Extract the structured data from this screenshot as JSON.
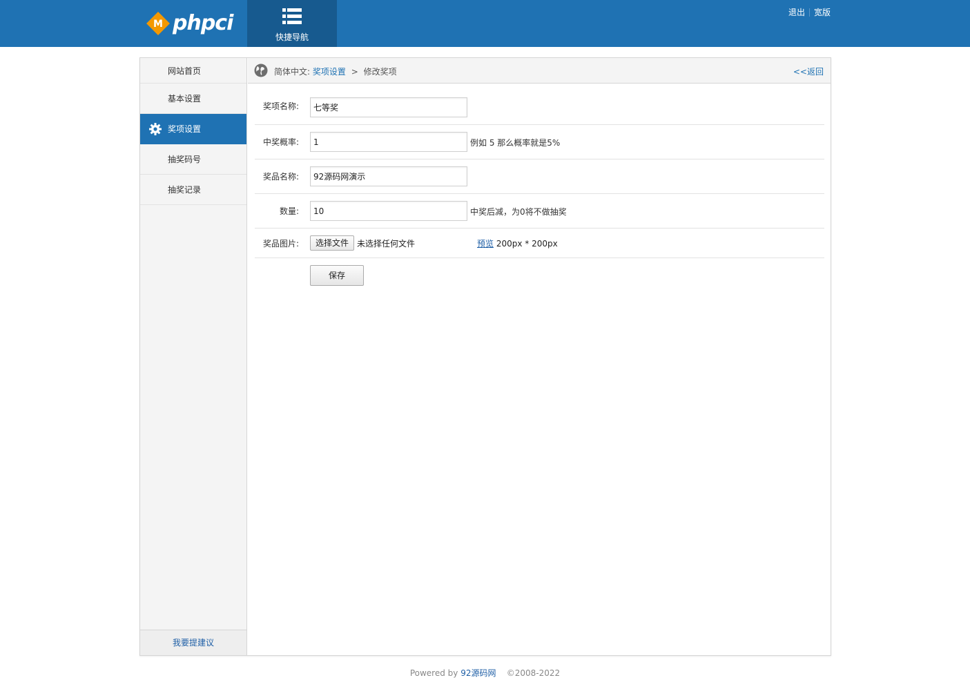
{
  "header": {
    "logo_text": "phpci",
    "logo_letter": "M",
    "quick_nav_label": "快捷导航",
    "logout_label": "退出",
    "wide_label": "宽版",
    "colors": {
      "bar": "#1f72b3",
      "quicknav": "#175a8f",
      "logo_orange": "#f39800"
    }
  },
  "sidebar": {
    "items": [
      {
        "label": "网站首页",
        "active": false
      },
      {
        "label": "基本设置",
        "active": false
      },
      {
        "label": "奖项设置",
        "active": true,
        "icon": "gear-icon"
      },
      {
        "label": "抽奖码号",
        "active": false
      },
      {
        "label": "抽奖记录",
        "active": false
      }
    ],
    "feedback_label": "我要提建议"
  },
  "breadcrumb": {
    "root": "简体中文:",
    "link": "奖项设置",
    "separator": ">",
    "current": "修改奖项",
    "back_label": "<<返回"
  },
  "form": {
    "prize_name": {
      "label": "奖项名称:",
      "value": "七等奖"
    },
    "probability": {
      "label": "中奖概率:",
      "value": "1",
      "hint": "例如 5 那么概率就是5%"
    },
    "goods_name": {
      "label": "奖品名称:",
      "value": "92源码网演示"
    },
    "quantity": {
      "label": "数量:",
      "value": "10",
      "hint": "中奖后减，为0将不做抽奖"
    },
    "image": {
      "label": "奖品图片:",
      "choose_label": "选择文件",
      "status": "未选择任何文件",
      "preview_label": "预览",
      "size_note": "200px * 200px"
    },
    "save_label": "保存"
  },
  "footer": {
    "powered_by": "Powered by",
    "brand": "92源码网",
    "copyright": "©2008-2022"
  }
}
